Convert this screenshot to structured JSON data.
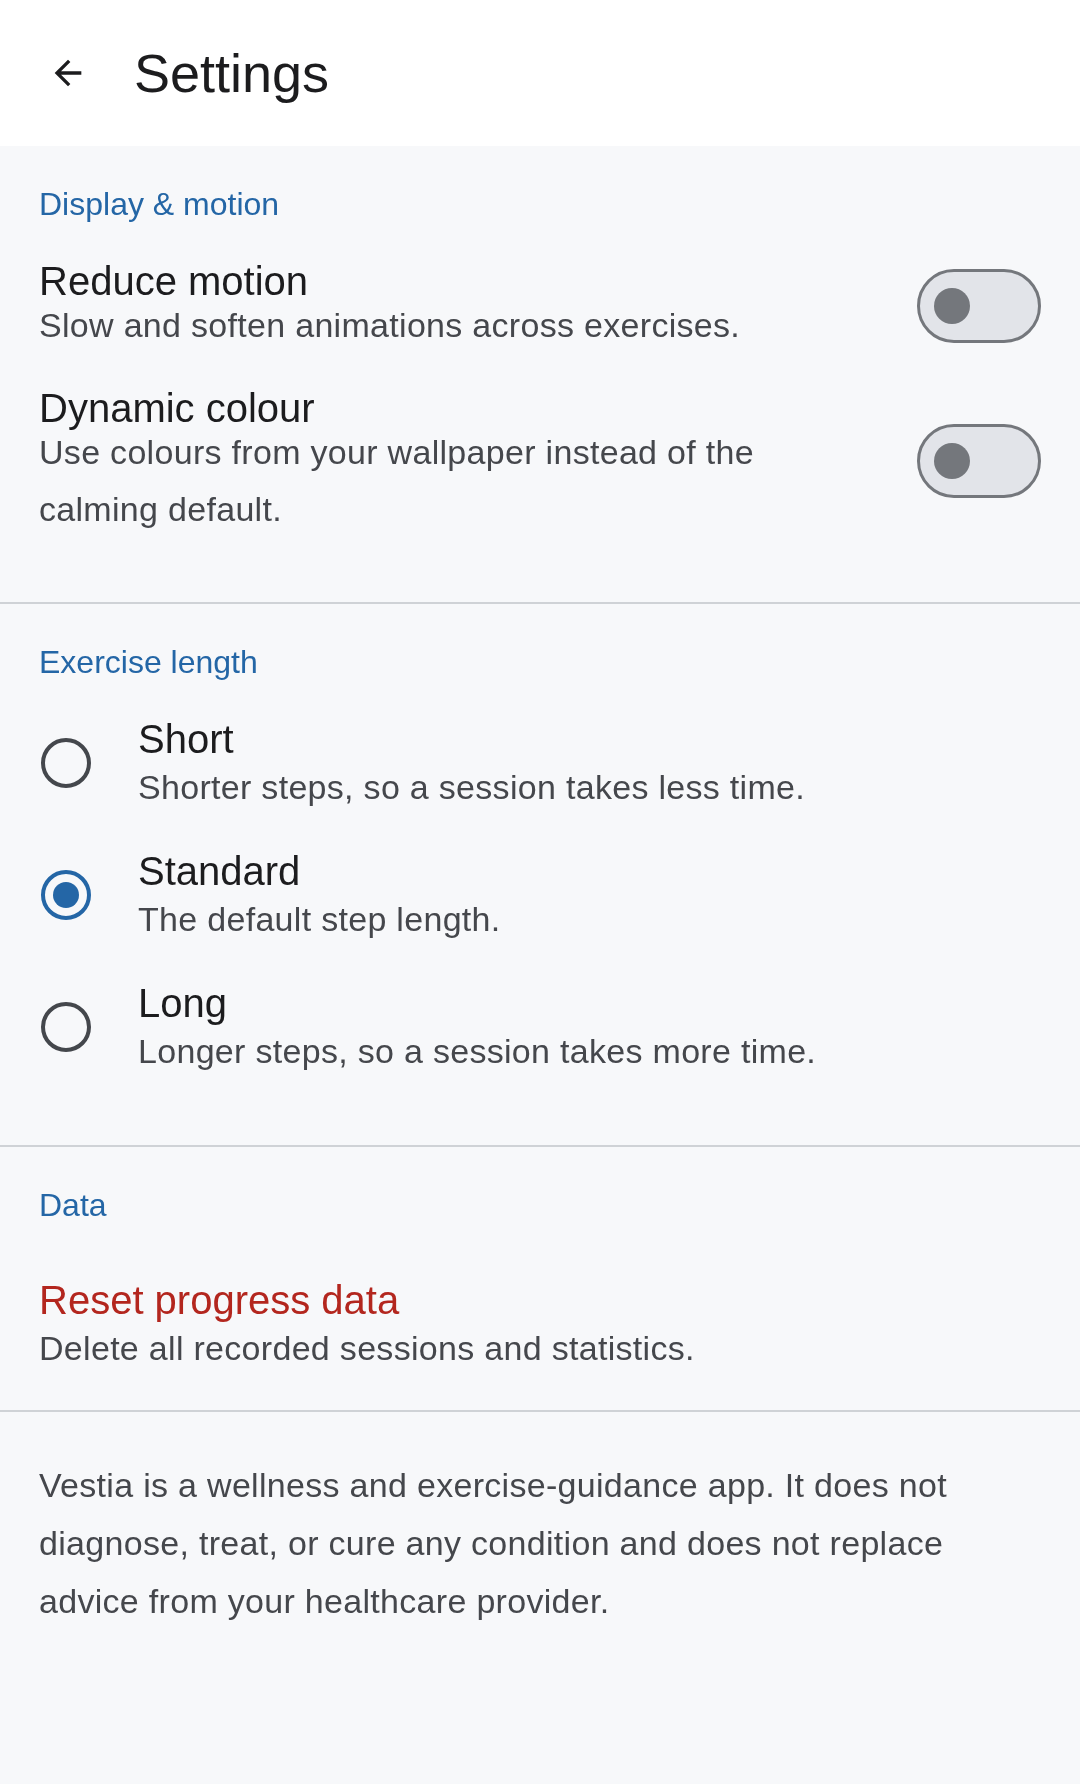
{
  "top_bar": {
    "title": "Settings"
  },
  "sections": [
    {
      "title": "Display & motion",
      "kind": "toggles",
      "items": [
        {
          "title": "Reduce motion",
          "subtitle": "Slow and soften animations across exercises.",
          "on": false
        },
        {
          "title": "Dynamic colour",
          "subtitle": "Use colours from your wallpaper instead of the calming default.",
          "on": false
        }
      ]
    },
    {
      "title": "Exercise length",
      "kind": "radios",
      "items": [
        {
          "title": "Short",
          "subtitle": "Shorter steps, so a session takes less time.",
          "selected": false
        },
        {
          "title": "Standard",
          "subtitle": "The default step length.",
          "selected": true
        },
        {
          "title": "Long",
          "subtitle": "Longer steps, so a session takes more time.",
          "selected": false
        }
      ]
    },
    {
      "title": "Data",
      "kind": "actions",
      "items": [
        {
          "title": "Reset progress data",
          "subtitle": "Delete all recorded sessions and statistics."
        }
      ]
    }
  ],
  "disclaimer": "Vestia is a wellness and exercise-guidance app. It does not diagnose, treat, or cure any condition and does not replace advice from your healthcare provider."
}
